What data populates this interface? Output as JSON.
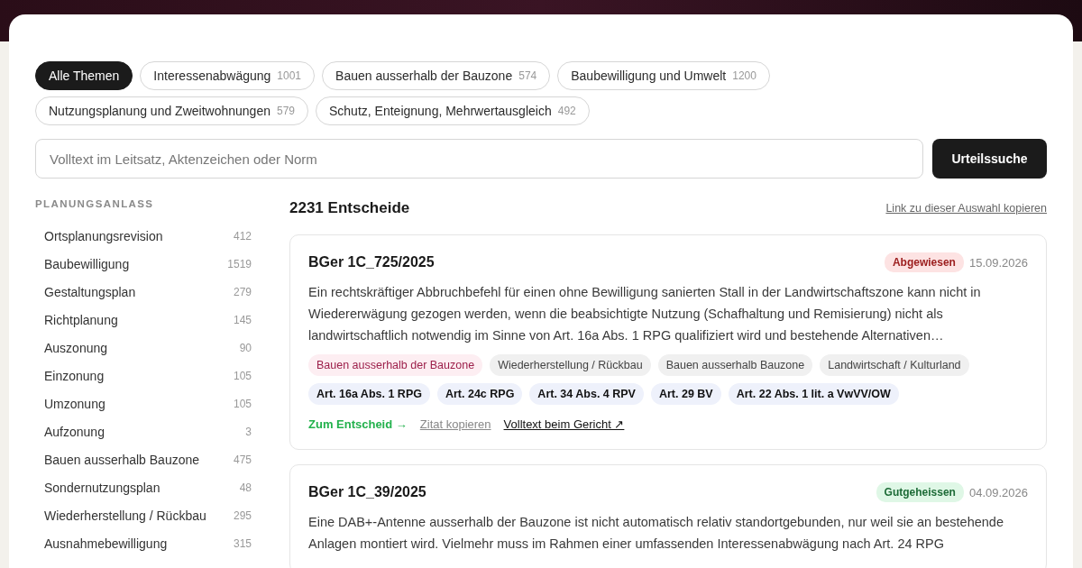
{
  "topics": [
    {
      "label": "Alle Themen",
      "selected": true
    },
    {
      "label": "Interessenabwägung",
      "count": "1001",
      "selected": false
    },
    {
      "label": "Bauen ausserhalb der Bauzone",
      "count": "574",
      "selected": false
    },
    {
      "label": "Baubewilligung und Umwelt",
      "count": "1200",
      "selected": false
    },
    {
      "label": "Nutzungsplanung und Zweitwohnungen",
      "count": "579",
      "selected": false
    },
    {
      "label": "Schutz, Enteignung, Mehrwertausgleich",
      "count": "492",
      "selected": false
    }
  ],
  "search": {
    "placeholder": "Volltext im Leitsatz, Aktenzeichen oder Norm",
    "button": "Urteilssuche"
  },
  "sidebar": {
    "heading": "PLANUNGSANLASS",
    "items": [
      {
        "label": "Ortsplanungsrevision",
        "count": "412"
      },
      {
        "label": "Baubewilligung",
        "count": "1519"
      },
      {
        "label": "Gestaltungsplan",
        "count": "279"
      },
      {
        "label": "Richtplanung",
        "count": "145"
      },
      {
        "label": "Auszonung",
        "count": "90"
      },
      {
        "label": "Einzonung",
        "count": "105"
      },
      {
        "label": "Umzonung",
        "count": "105"
      },
      {
        "label": "Aufzonung",
        "count": "3"
      },
      {
        "label": "Bauen ausserhalb Bauzone",
        "count": "475"
      },
      {
        "label": "Sondernutzungsplan",
        "count": "48"
      },
      {
        "label": "Wiederherstellung / Rückbau",
        "count": "295"
      },
      {
        "label": "Ausnahmebewilligung",
        "count": "315"
      }
    ]
  },
  "results": {
    "count": "2231 Entscheide",
    "copy_link": "Link zu dieser Auswahl kopieren",
    "items": [
      {
        "title": "BGer 1C_725/2025",
        "status": {
          "label": "Abgewiesen",
          "kind": "rejected"
        },
        "date": "15.09.2026",
        "summary": "Ein rechtskräftiger Abbruchbefehl für einen ohne Bewilligung sanierten Stall in der Landwirtschaftszone kann nicht in Wiedererwägung gezogen werden, wenn die beabsichtigte Nutzung (Schafhaltung und Remisierung) nicht als landwirtschaftlich notwendig im Sinne von Art. 16a Abs. 1 RPG qualifiziert wird und bestehende Alternativen…",
        "tags": [
          {
            "label": "Bauen ausserhalb der Bauzone",
            "kind": "topic-main"
          },
          {
            "label": "Wiederherstellung / Rückbau",
            "kind": "topic"
          },
          {
            "label": "Bauen ausserhalb Bauzone",
            "kind": "topic"
          },
          {
            "label": "Landwirtschaft / Kulturland",
            "kind": "topic"
          }
        ],
        "norms": [
          "Art. 16a Abs. 1 RPG",
          "Art. 24c RPG",
          "Art. 34 Abs. 4 RPV",
          "Art. 29 BV",
          "Art. 22 Abs. 1 lit. a VwVV/OW"
        ],
        "links": {
          "open": "Zum Entscheid →",
          "cite": "Zitat kopieren",
          "fulltext": "Volltext beim Gericht ↗"
        }
      },
      {
        "title": "BGer 1C_39/2025",
        "status": {
          "label": "Gutgeheissen",
          "kind": "approved"
        },
        "date": "04.09.2026",
        "summary": "Eine DAB+-Antenne ausserhalb der Bauzone ist nicht automatisch relativ standortgebunden, nur weil sie an bestehende Anlagen montiert wird. Vielmehr muss im Rahmen einer umfassenden Interessenabwägung nach Art. 24 RPG"
      }
    ]
  }
}
